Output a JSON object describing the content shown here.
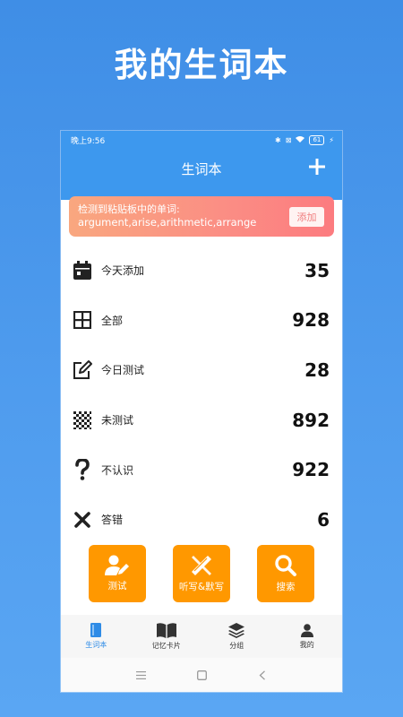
{
  "promo": {
    "title": "我的生词本"
  },
  "status_bar": {
    "time": "晚上9:56",
    "battery": "61"
  },
  "app_bar": {
    "title": "生词本"
  },
  "clipboard": {
    "label": "检测到粘贴板中的单词:",
    "words": "argument,arise,arithmetic,arrange",
    "add_label": "添加"
  },
  "stats": [
    {
      "label": "今天添加",
      "value": "35",
      "icon": "calendar-icon"
    },
    {
      "label": "全部",
      "value": "928",
      "icon": "grid-icon"
    },
    {
      "label": "今日测试",
      "value": "28",
      "icon": "edit-icon"
    },
    {
      "label": "未测试",
      "value": "892",
      "icon": "dots-grid-icon"
    },
    {
      "label": "不认识",
      "value": "922",
      "icon": "question-icon"
    },
    {
      "label": "答错",
      "value": "6",
      "icon": "cross-icon"
    }
  ],
  "actions": [
    {
      "label": "测试",
      "icon": "user-edit-icon"
    },
    {
      "label": "听写&默写",
      "icon": "pencil-ruler-icon"
    },
    {
      "label": "搜索",
      "icon": "search-icon"
    }
  ],
  "tabs": [
    {
      "label": "生词本",
      "icon": "notebook-icon",
      "active": true
    },
    {
      "label": "记忆卡片",
      "icon": "book-icon",
      "active": false
    },
    {
      "label": "分组",
      "icon": "layers-icon",
      "active": false
    },
    {
      "label": "我的",
      "icon": "person-icon",
      "active": false
    }
  ],
  "colors": {
    "background": "#4a97ec",
    "app_bar": "#3d98ee",
    "action": "#ff9800",
    "banner_start": "#f9a77f",
    "banner_end": "#fc7b7f",
    "tab_active": "#2e8be6"
  }
}
